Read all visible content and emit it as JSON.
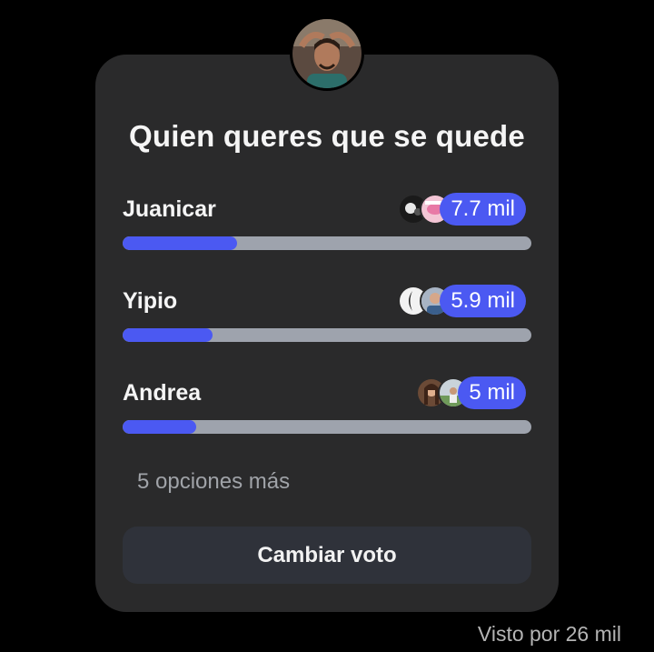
{
  "poll": {
    "title": "Quien queres que se quede",
    "options": [
      {
        "label": "Juanicar",
        "count": "7.7 mil",
        "fill": 0.28,
        "voters": [
          "voter-avatar",
          "voter-avatar"
        ]
      },
      {
        "label": "Yipio",
        "count": "5.9 mil",
        "fill": 0.22,
        "voters": [
          "voter-avatar",
          "voter-avatar"
        ]
      },
      {
        "label": "Andrea",
        "count": "5 mil",
        "fill": 0.18,
        "voters": [
          "voter-avatar",
          "voter-avatar"
        ]
      }
    ],
    "more_options": "5 opciones más",
    "change_vote_label": "Cambiar voto"
  },
  "footer": {
    "seen_by": "Visto por 26 mil"
  },
  "colors": {
    "accent": "#4b59f2",
    "track": "#9ea3ad",
    "card": "#2a2a2b",
    "button": "#2f323a",
    "background": "#000000"
  }
}
